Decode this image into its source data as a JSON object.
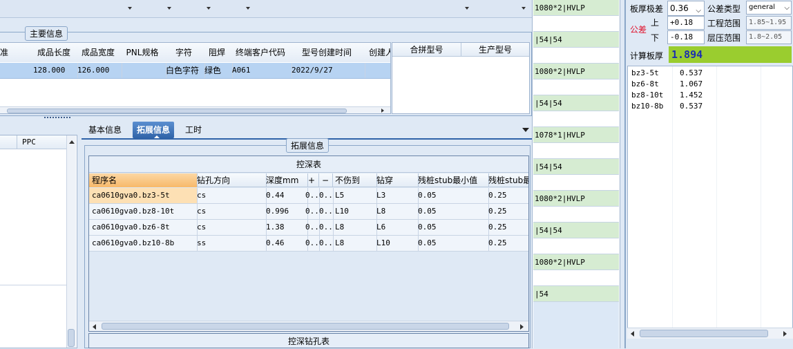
{
  "main_info": {
    "group_title": "主要信息",
    "columns": [
      "准",
      "成品长度",
      "成品宽度",
      "PNL规格",
      "字符",
      "阻焊",
      "终端客户代码",
      "型号创建时间",
      "创建人"
    ],
    "row": [
      "",
      "128.000",
      "126.000",
      "",
      "白色字符",
      "绿色",
      "A061",
      "2022/9/27",
      ""
    ],
    "panel_columns": [
      "合拼型号",
      "生产型号"
    ]
  },
  "left_list": {
    "column": "PPC"
  },
  "tabs": [
    "基本信息",
    "拓展信息",
    "工时"
  ],
  "active_tab": "拓展信息",
  "ext_group_title": "拓展信息",
  "depth_table": {
    "title": "控深表",
    "columns": [
      "程序名",
      "钻孔方向",
      "深度mm",
      "+",
      "−",
      "不伤到",
      "钻穿",
      "残桩stub最小值",
      "残桩stub最"
    ],
    "rows": [
      [
        "ca0610gva0.bz3-5t",
        "cs",
        "0.44",
        "0..",
        "0..",
        "L5",
        "L3",
        "0.05",
        "0.25"
      ],
      [
        "ca0610gva0.bz8-10t",
        "cs",
        "0.996",
        "0..",
        "0..",
        "L10",
        "L8",
        "0.05",
        "0.25"
      ],
      [
        "ca0610gva0.bz6-8t",
        "cs",
        "1.38",
        "0..",
        "0..",
        "L8",
        "L6",
        "0.05",
        "0.25"
      ],
      [
        "ca0610gva0.bz10-8b",
        "ss",
        "0.46",
        "0..",
        "0..",
        "L8",
        "L10",
        "0.05",
        "0.25"
      ]
    ]
  },
  "drill_table_title": "控深钻孔表",
  "middle_list": [
    {
      "text": "1080*2|HVLP",
      "color": "green"
    },
    {
      "text": "",
      "color": "white"
    },
    {
      "text": "|54|54",
      "color": "green"
    },
    {
      "text": "",
      "color": "white"
    },
    {
      "text": "1080*2|HVLP",
      "color": "green"
    },
    {
      "text": "",
      "color": "white"
    },
    {
      "text": "|54|54",
      "color": "green"
    },
    {
      "text": "",
      "color": "white"
    },
    {
      "text": "1078*1|HVLP",
      "color": "green"
    },
    {
      "text": "",
      "color": "white"
    },
    {
      "text": "|54|54",
      "color": "green"
    },
    {
      "text": "",
      "color": "white"
    },
    {
      "text": "1080*2|HVLP",
      "color": "green"
    },
    {
      "text": "",
      "color": "white"
    },
    {
      "text": "|54|54",
      "color": "green"
    },
    {
      "text": "",
      "color": "white"
    },
    {
      "text": "1080*2|HVLP",
      "color": "green"
    },
    {
      "text": "",
      "color": "white"
    },
    {
      "text": "|54",
      "color": "green"
    }
  ],
  "right_panel": {
    "thickness_tol_label": "板厚极差",
    "thickness_tol_value": "0.36",
    "tol_type_label": "公差类型",
    "tol_type_value": "general",
    "tol_label": "公差",
    "upper_label": "上",
    "upper_value": "+0.18",
    "lower_label": "下",
    "lower_value": "-0.18",
    "eng_range_label": "工程范围",
    "eng_range_value": "1.85~1.95",
    "press_range_label": "层压范围",
    "press_range_value": "1.8~2.05",
    "calc_label": "计算板厚",
    "calc_value": "1.894",
    "items": [
      {
        "name": "bz3-5t",
        "value": "0.537"
      },
      {
        "name": "bz6-8t",
        "value": "1.067"
      },
      {
        "name": "bz8-10t",
        "value": "1.452"
      },
      {
        "name": "bz10-8b",
        "value": "0.537"
      }
    ]
  }
}
